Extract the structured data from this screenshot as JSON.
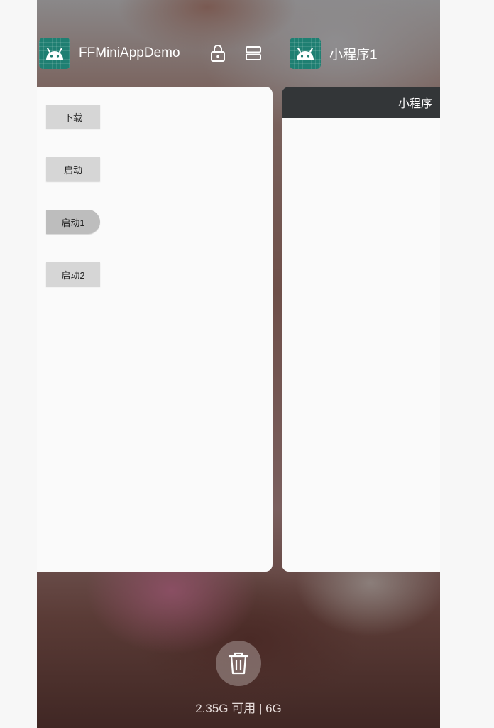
{
  "recents": {
    "apps": [
      {
        "title": "FFMiniAppDemo",
        "icon": "android-icon",
        "buttons": [
          {
            "label": "下载"
          },
          {
            "label": "启动"
          },
          {
            "label": "启动1"
          },
          {
            "label": "启动2"
          }
        ]
      },
      {
        "title": "小程序1",
        "icon": "android-icon",
        "toolbar_title": "小程序"
      }
    ],
    "lock_icon": "lock-icon",
    "split_icon": "split-screen-icon",
    "clear_icon": "trash-icon",
    "memory": "2.35G 可用 | 6G"
  },
  "colors": {
    "app_icon_bg": "#1f7f72",
    "toolbar_bg": "#333638",
    "card_bg": "#fafafa"
  }
}
